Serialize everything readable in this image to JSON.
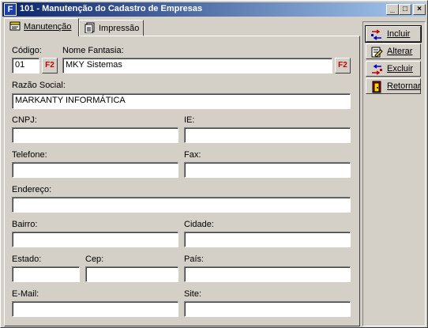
{
  "window": {
    "icon_letter": "F",
    "title": "101 - Manutenção do Cadastro de Empresas",
    "controls": {
      "minimize": "_",
      "maximize": "□",
      "close": "×"
    }
  },
  "tabs": [
    {
      "label": "Manutenção",
      "icon": "form-icon",
      "active": true
    },
    {
      "label": "Impressão",
      "icon": "printer-doc-icon",
      "active": false
    }
  ],
  "form": {
    "codigo": {
      "label": "Código:",
      "value": "01",
      "lookup": "F2"
    },
    "nome_fantasia": {
      "label": "Nome Fantasia:",
      "value": "MKY Sistemas",
      "lookup": "F2"
    },
    "razao_social": {
      "label": "Razão Social:",
      "value": "MARKANTY INFORMÁTICA"
    },
    "cnpj": {
      "label": "CNPJ:",
      "value": ""
    },
    "ie": {
      "label": "IE:",
      "value": ""
    },
    "telefone": {
      "label": "Telefone:",
      "value": ""
    },
    "fax": {
      "label": "Fax:",
      "value": ""
    },
    "endereco": {
      "label": "Endereço:",
      "value": ""
    },
    "bairro": {
      "label": "Bairro:",
      "value": ""
    },
    "cidade": {
      "label": "Cidade:",
      "value": ""
    },
    "estado": {
      "label": "Estado:",
      "value": ""
    },
    "cep": {
      "label": "Cep:",
      "value": ""
    },
    "pais": {
      "label": "País:",
      "value": ""
    },
    "email": {
      "label": "E-Mail:",
      "value": ""
    },
    "site": {
      "label": "Site:",
      "value": ""
    }
  },
  "actions": [
    {
      "label": "Incluir",
      "icon": "add-icon"
    },
    {
      "label": "Alterar",
      "icon": "edit-icon"
    },
    {
      "label": "Excluir",
      "icon": "delete-icon"
    },
    {
      "label": "Retornar",
      "icon": "exit-door-icon"
    }
  ],
  "colors": {
    "titlebar_start": "#0a246a",
    "titlebar_end": "#a6caf0",
    "f2_text": "#c00000",
    "face": "#d4d0c8"
  }
}
